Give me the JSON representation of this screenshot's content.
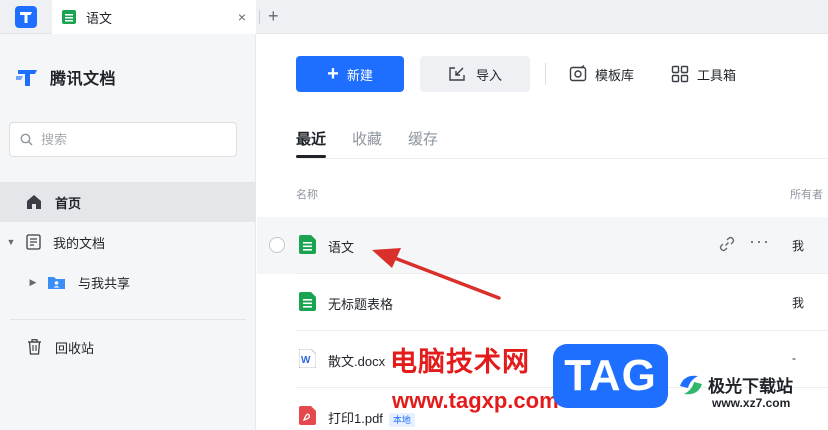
{
  "tabbar": {
    "open_tab": {
      "label": "语文",
      "close": "×"
    },
    "add": "+"
  },
  "sidebar": {
    "brand": "腾讯文档",
    "search_placeholder": "搜索",
    "items": [
      {
        "label": "首页",
        "active": true
      },
      {
        "label": "我的文档",
        "caret": "▼"
      },
      {
        "label": "与我共享",
        "caret": "▶"
      },
      {
        "label": "回收站"
      }
    ]
  },
  "toolbar": {
    "new_label": "新建",
    "import_label": "导入",
    "template_label": "模板库",
    "tools_label": "工具箱"
  },
  "tabs": [
    {
      "label": "最近",
      "active": true
    },
    {
      "label": "收藏"
    },
    {
      "label": "缓存"
    }
  ],
  "columns": {
    "name": "名称",
    "owner": "所有者"
  },
  "files": [
    {
      "name": "语文",
      "type": "sheet",
      "owner": "我"
    },
    {
      "name": "无标题表格",
      "type": "sheet",
      "owner": "我"
    },
    {
      "name": "散文.docx",
      "type": "word",
      "owner": "-"
    },
    {
      "name": "打印1.pdf",
      "type": "pdf",
      "badge": "本地",
      "owner": ""
    }
  ],
  "watermark": {
    "text": "电脑技术网",
    "url": "www.tagxp.com",
    "tag": "TAG",
    "site": "极光下载站",
    "site_url": "www.xz7.com"
  },
  "colors": {
    "accent": "#1e6fff",
    "sheet_green": "#1aa350",
    "pdf_red": "#e5484d",
    "word_blue": "#2b68d9",
    "annotation_red": "#d9302c"
  }
}
